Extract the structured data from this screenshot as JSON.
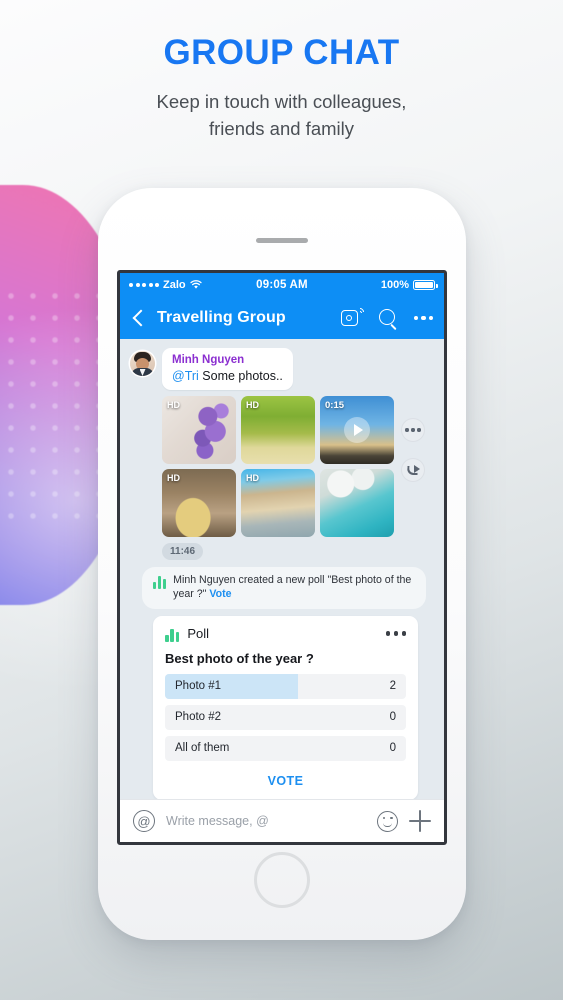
{
  "promo": {
    "title": "GROUP CHAT",
    "subtitle_line1": "Keep in touch with colleagues,",
    "subtitle_line2": "friends and family"
  },
  "status_bar": {
    "carrier": "Zalo",
    "time": "09:05 AM",
    "battery_percent": "100%"
  },
  "navbar": {
    "title": "Travelling Group",
    "icons": [
      "back-chevron-icon",
      "live-camera-icon",
      "search-icon",
      "more-icon"
    ]
  },
  "message": {
    "sender": "Minh Nguyen",
    "mention": "@Tri",
    "text": " Some photos..",
    "timestamp": "11:46"
  },
  "media": {
    "items": [
      {
        "badge": "HD",
        "type": "photo",
        "art": "t1"
      },
      {
        "badge": "HD",
        "type": "photo",
        "art": "t2"
      },
      {
        "badge": "0:15",
        "type": "video",
        "art": "t3"
      },
      {
        "badge": "HD",
        "type": "photo",
        "art": "t4"
      },
      {
        "badge": "HD",
        "type": "photo",
        "art": "t5"
      },
      {
        "badge": "",
        "type": "photo",
        "art": "t6"
      }
    ],
    "actions": [
      "more-icon",
      "share-icon"
    ]
  },
  "system_message": {
    "text": "Minh Nguyen created a new poll \"Best photo of the year ?\"",
    "link": "Vote"
  },
  "poll": {
    "header": "Poll",
    "question": "Best photo of the year ?",
    "options": [
      {
        "label": "Photo #1",
        "count": "2",
        "fill_percent": 55
      },
      {
        "label": "Photo #2",
        "count": "0",
        "fill_percent": 0
      },
      {
        "label": "All of them",
        "count": "0",
        "fill_percent": 0
      }
    ],
    "vote_label": "VOTE"
  },
  "composer": {
    "at_symbol": "@",
    "placeholder": "Write message, @"
  },
  "colors": {
    "brand_blue": "#0d8ef5",
    "title_blue": "#1877f2",
    "link_blue": "#1d8ff0",
    "sender_purple": "#8b2fd0",
    "poll_fill": "#cce5f7",
    "poll_bar_green": "#3ecf8e",
    "chat_bg": "#e4eaef"
  }
}
